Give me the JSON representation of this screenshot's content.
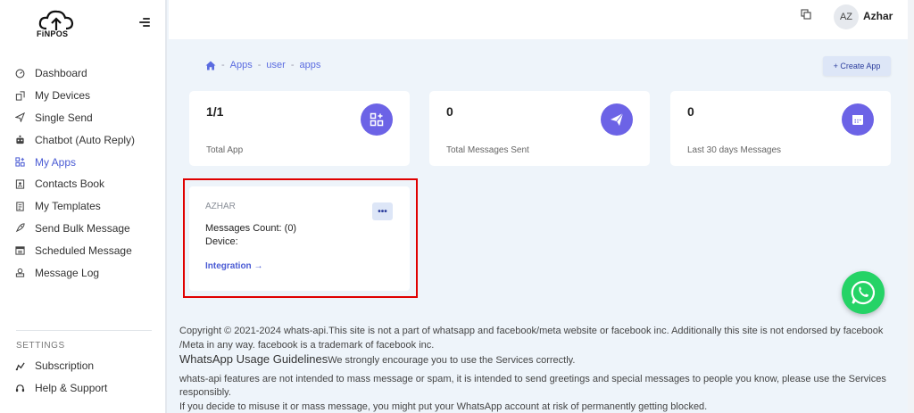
{
  "brand": {
    "logo_text": "FiNPOS"
  },
  "sidebar": {
    "items": [
      {
        "label": "Dashboard",
        "icon": "dashboard-icon"
      },
      {
        "label": "My Devices",
        "icon": "devices-icon"
      },
      {
        "label": "Single Send",
        "icon": "send-icon"
      },
      {
        "label": "Chatbot (Auto Reply)",
        "icon": "robot-icon"
      },
      {
        "label": "My Apps",
        "icon": "apps-icon",
        "active": true
      },
      {
        "label": "Contacts Book",
        "icon": "contacts-icon"
      },
      {
        "label": "My Templates",
        "icon": "templates-icon"
      },
      {
        "label": "Send Bulk Message",
        "icon": "rocket-icon"
      },
      {
        "label": "Scheduled Message",
        "icon": "calendar-icon"
      },
      {
        "label": "Message Log",
        "icon": "log-icon"
      }
    ],
    "settings_label": "SETTINGS",
    "settings_items": [
      {
        "label": "Subscription",
        "icon": "subscription-icon"
      },
      {
        "label": "Help & Support",
        "icon": "support-icon"
      }
    ]
  },
  "header": {
    "avatar_initials": "AZ",
    "user_name": "Azhar"
  },
  "breadcrumb": {
    "items": [
      "Apps",
      "user",
      "apps"
    ],
    "separator": "-"
  },
  "actions": {
    "create_app_label": "+ Create App"
  },
  "stats": [
    {
      "value": "1/1",
      "label": "Total App",
      "icon": "apps-icon"
    },
    {
      "value": "0",
      "label": "Total Messages Sent",
      "icon": "paper-plane-icon"
    },
    {
      "value": "0",
      "label": "Last 30 days Messages",
      "icon": "calendar-icon"
    }
  ],
  "app_card": {
    "name": "AZHAR",
    "messages_count": "Messages Count: (0)",
    "device": "Device:",
    "more_label": "•••",
    "integration_label": "Integration →"
  },
  "footer": {
    "copyright": "Copyright © 2021-2024 whats-api.This site is not a part of whatsapp and facebook/meta website or facebook inc. Additionally this site is not endorsed by facebook /Meta in any way. facebook is a trademark of facebook inc.",
    "guidelines_title": "WhatsApp Usage Guidelines",
    "guidelines_intro": "We strongly encourage you to use the Services correctly.",
    "notice_1": "whats-api features are not intended to mass message or spam, it is intended to send greetings and special messages to people you know, please use the Services responsibly.",
    "notice_2": "If you decide to misuse it or mass message, you might put your WhatsApp account at risk of permanently getting blocked."
  },
  "colors": {
    "accent": "#4a5bd4",
    "stat_icon": "#6c63e6",
    "highlight": "#e00000",
    "whatsapp": "#25d366"
  }
}
